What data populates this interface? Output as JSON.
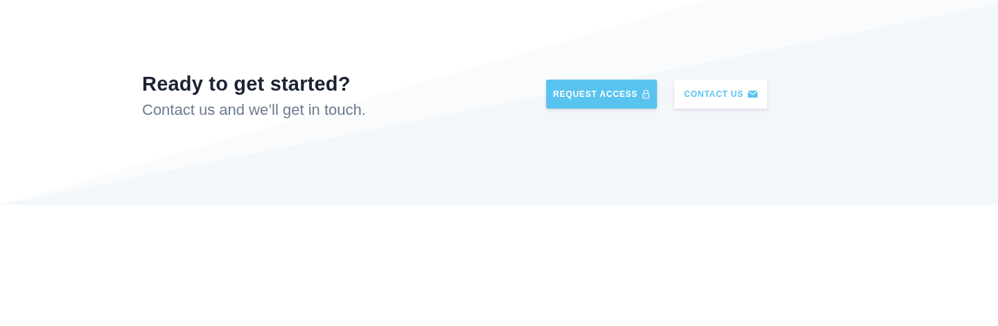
{
  "cta": {
    "heading": "Ready to get started?",
    "subheading": "Contact us and we’ll get in touch.",
    "buttons": [
      {
        "label": "REQUEST ACCESS",
        "kind": "primary"
      },
      {
        "label": "CONTACT US",
        "kind": "secondary"
      }
    ]
  }
}
